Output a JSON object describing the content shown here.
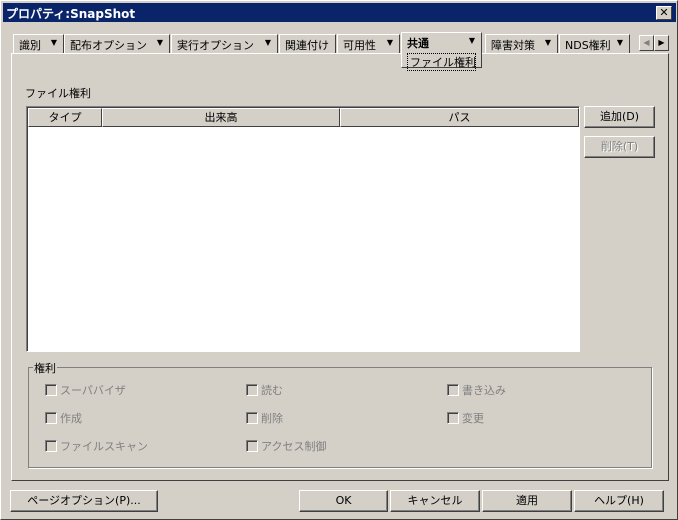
{
  "window": {
    "title": "プロパティ:SnapShot",
    "close": "✕"
  },
  "tabs": [
    {
      "label": "識別"
    },
    {
      "label": "配布オプション"
    },
    {
      "label": "実行オプション"
    },
    {
      "label": "関連付け"
    },
    {
      "label": "可用性"
    },
    {
      "label": "共通",
      "sub": "ファイル権利"
    },
    {
      "label": "障害対策"
    },
    {
      "label": "NDS権利"
    }
  ],
  "tab_arrow": "▼",
  "scroll": {
    "left": "◀",
    "right": "▶"
  },
  "section_label": "ファイル権利",
  "table": {
    "columns": [
      "タイプ",
      "出来高",
      "パス"
    ],
    "rows": []
  },
  "side_buttons": {
    "add": "追加(D)",
    "delete": "削除(T)"
  },
  "rights": {
    "label": "権利",
    "items": [
      "スーパバイザ",
      "読む",
      "書き込み",
      "作成",
      "削除",
      "変更",
      "ファイルスキャン",
      "アクセス制御"
    ]
  },
  "footer": {
    "page_options": "ページオプション(P)...",
    "ok": "OK",
    "cancel": "キャンセル",
    "apply": "適用",
    "help": "ヘルプ(H)"
  }
}
